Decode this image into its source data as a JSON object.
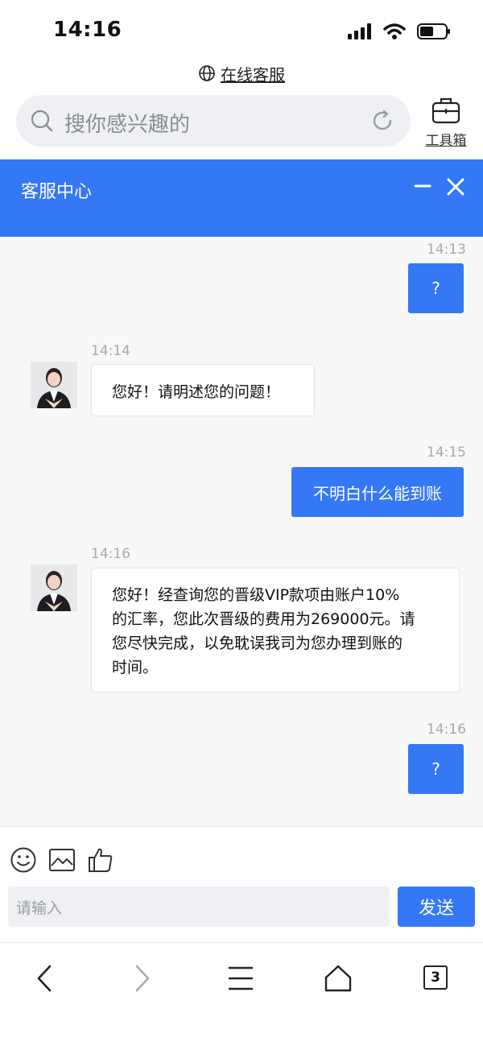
{
  "status_bar": {
    "time": "14:16"
  },
  "browser": {
    "url_text": "在线客服",
    "search_placeholder": "搜你感兴趣的",
    "toolbox_label": "工具箱",
    "tab_count": "3"
  },
  "chat": {
    "header_title": "客服中心",
    "messages": [
      {
        "sender": "user",
        "time": "14:13",
        "text": "?"
      },
      {
        "sender": "agent",
        "time": "14:14",
        "text": "您好！请明述您的问题！"
      },
      {
        "sender": "user",
        "time": "14:15",
        "text": "不明白什么能到账"
      },
      {
        "sender": "agent",
        "time": "14:16",
        "lines": [
          "您好！经查询您的晋级VIP款项由账户10%",
          "的汇率，您此次晋级的费用为269000元。请",
          "您尽快完成，以免耽误我司为您办理到账的",
          "时间。"
        ]
      },
      {
        "sender": "user",
        "time": "14:16",
        "text": "?"
      }
    ]
  },
  "input": {
    "placeholder": "请输入",
    "send_label": "发送"
  },
  "colors": {
    "accent": "#3478f6",
    "chat_bg": "#f8f8f9"
  },
  "icons": [
    "globe-icon",
    "search-icon",
    "refresh-icon",
    "toolbox-icon",
    "minimize-icon",
    "close-icon",
    "emoji-icon",
    "image-icon",
    "thumbs-up-icon",
    "back-icon",
    "forward-icon",
    "menu-icon",
    "home-icon"
  ]
}
